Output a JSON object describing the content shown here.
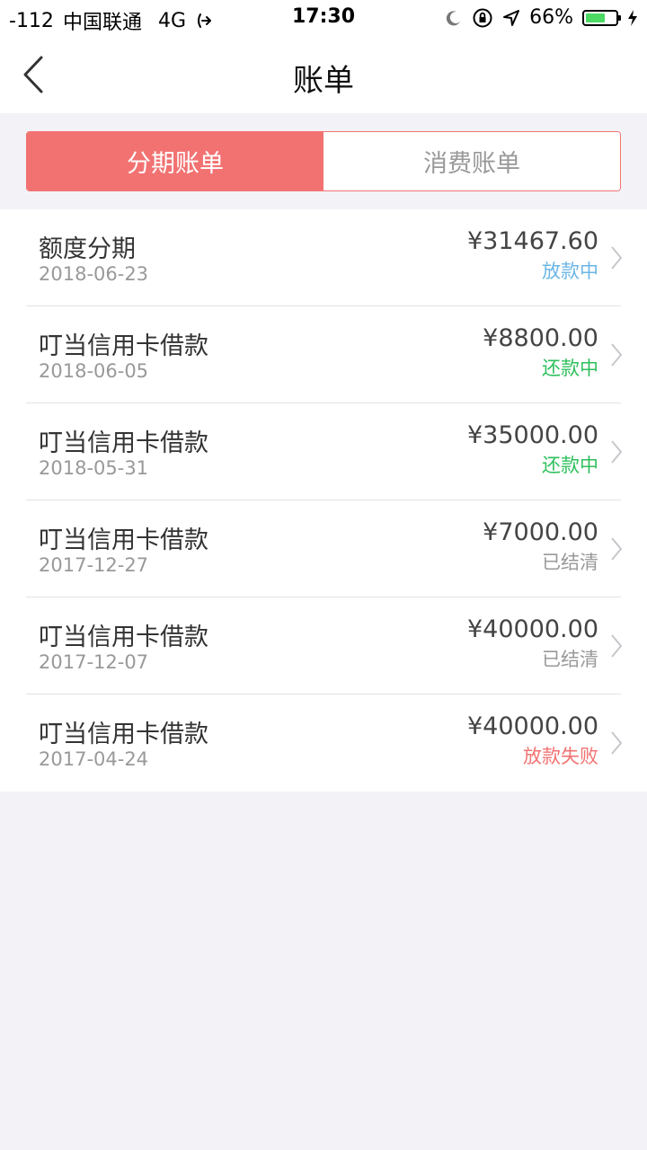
{
  "status_bar": {
    "signal": "-112",
    "carrier": "中国联通",
    "network": "4G",
    "time": "17:30",
    "battery_percent_text": "66%",
    "battery_level": 0.66
  },
  "nav": {
    "title": "账单"
  },
  "tabs": [
    {
      "label": "分期账单",
      "active": true
    },
    {
      "label": "消费账单",
      "active": false
    }
  ],
  "bills": [
    {
      "title": "额度分期",
      "date": "2018-06-23",
      "amount": "¥31467.60",
      "status": "放款中",
      "status_color": "#6cb6e6"
    },
    {
      "title": "叮当信用卡借款",
      "date": "2018-06-05",
      "amount": "¥8800.00",
      "status": "还款中",
      "status_color": "#2fbf5c"
    },
    {
      "title": "叮当信用卡借款",
      "date": "2018-05-31",
      "amount": "¥35000.00",
      "status": "还款中",
      "status_color": "#2fbf5c"
    },
    {
      "title": "叮当信用卡借款",
      "date": "2017-12-27",
      "amount": "¥7000.00",
      "status": "已结清",
      "status_color": "#999999"
    },
    {
      "title": "叮当信用卡借款",
      "date": "2017-12-07",
      "amount": "¥40000.00",
      "status": "已结清",
      "status_color": "#999999"
    },
    {
      "title": "叮当信用卡借款",
      "date": "2017-04-24",
      "amount": "¥40000.00",
      "status": "放款失败",
      "status_color": "#f27272"
    }
  ],
  "colors": {
    "accent": "#f27272",
    "background": "#f3f3f7"
  },
  "icons": {
    "back": "chevron-left-icon",
    "row_arrow": "chevron-right-icon",
    "call_forward": "call-forward-icon",
    "moon": "moon-icon",
    "orientation_lock": "orientation-lock-icon",
    "location": "location-arrow-icon",
    "battery": "battery-icon",
    "charging": "charging-bolt-icon"
  }
}
